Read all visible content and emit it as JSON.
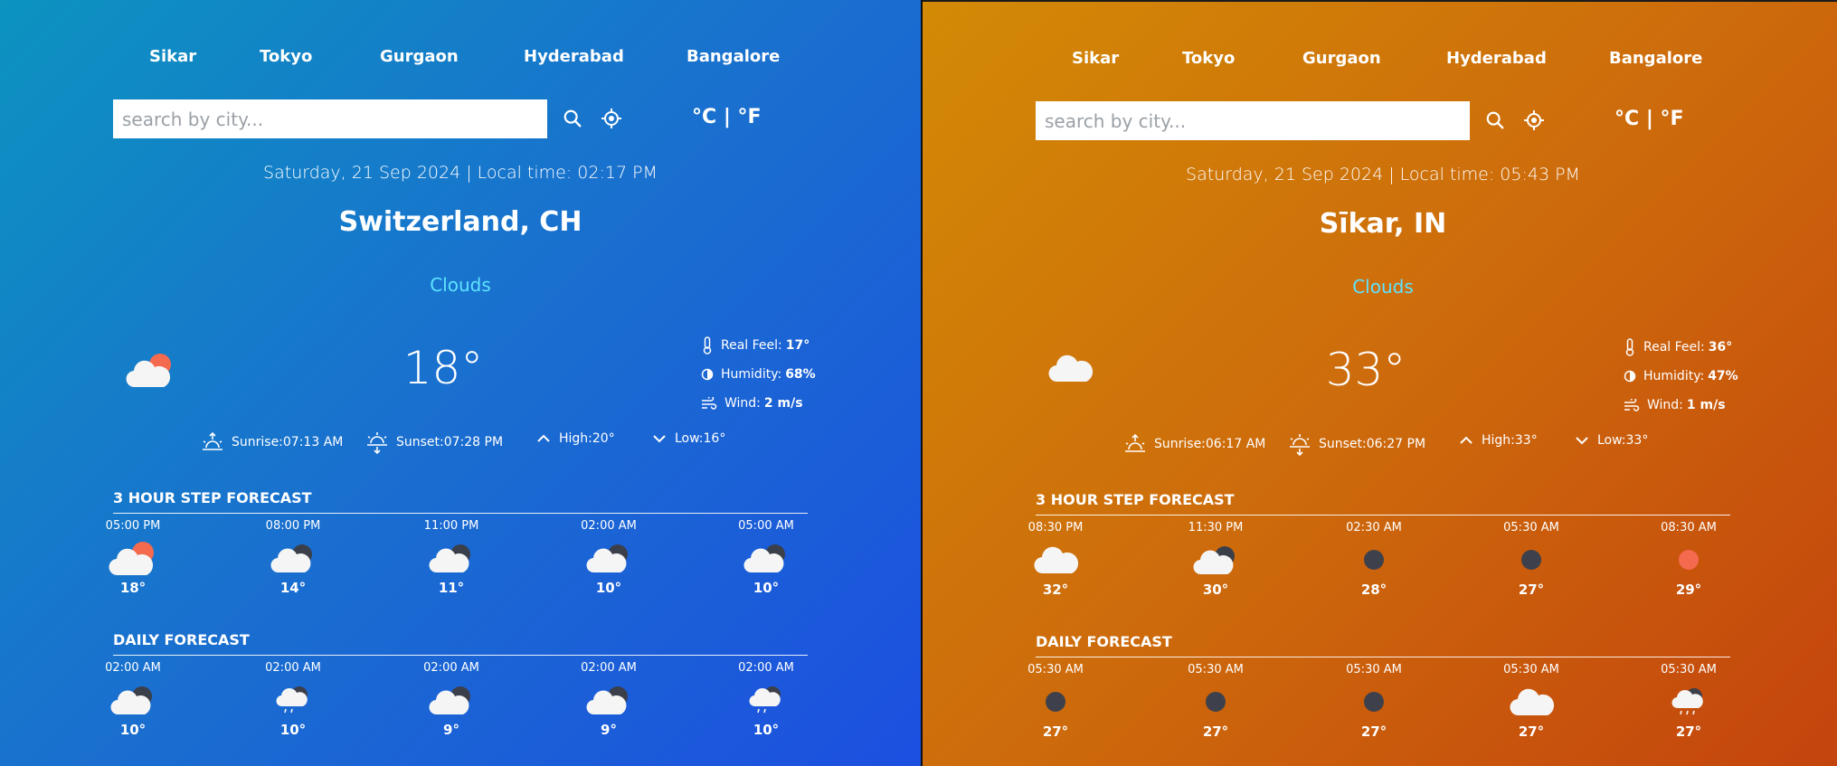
{
  "theme_colors": {
    "left_gradient": [
      "#0c93c0",
      "#1c4fe0"
    ],
    "right_gradient": [
      "#d38a05",
      "#c4440d"
    ],
    "condition_color": "#5fe3ff"
  },
  "panels": [
    {
      "cities": [
        "Sikar",
        "Tokyo",
        "Gurgaon",
        "Hyderabad",
        "Bangalore"
      ],
      "search": {
        "placeholder": "search by city...",
        "value": ""
      },
      "units": {
        "celsius": "°C",
        "separator": "|",
        "fahrenheit": "°F"
      },
      "datetime": "Saturday, 21 Sep 2024 | Local time: 02:17 PM",
      "location": "Switzerland, CH",
      "condition": "Clouds",
      "main_icon": "cloud-sun-icon",
      "temperature": "18°",
      "details": {
        "real_feel_label": "Real Feel:",
        "real_feel": "17°",
        "humidity_label": "Humidity:",
        "humidity": "68%",
        "wind_label": "Wind:",
        "wind": "2 m/s"
      },
      "sun": {
        "sunrise": "Sunrise:07:13 AM",
        "sunset": "Sunset:07:28 PM",
        "high": "High:20°",
        "low": "Low:16°"
      },
      "hourly_title": "3 HOUR STEP FORECAST",
      "hourly": [
        {
          "time": "05:00 PM",
          "temp": "18°",
          "icon": "cloud-sun-icon"
        },
        {
          "time": "08:00 PM",
          "temp": "14°",
          "icon": "cloud-moon-icon"
        },
        {
          "time": "11:00 PM",
          "temp": "11°",
          "icon": "cloud-moon-icon"
        },
        {
          "time": "02:00 AM",
          "temp": "10°",
          "icon": "cloud-moon-icon"
        },
        {
          "time": "05:00 AM",
          "temp": "10°",
          "icon": "cloud-moon-icon"
        }
      ],
      "daily_title": "DAILY FORECAST",
      "daily": [
        {
          "time": "02:00 AM",
          "temp": "10°",
          "icon": "cloud-moon-icon"
        },
        {
          "time": "02:00 AM",
          "temp": "10°",
          "icon": "cloud-moon-rain-icon"
        },
        {
          "time": "02:00 AM",
          "temp": "9°",
          "icon": "cloud-moon-icon"
        },
        {
          "time": "02:00 AM",
          "temp": "9°",
          "icon": "cloud-moon-icon"
        },
        {
          "time": "02:00 AM",
          "temp": "10°",
          "icon": "cloud-moon-rain-icon"
        }
      ]
    },
    {
      "cities": [
        "Sikar",
        "Tokyo",
        "Gurgaon",
        "Hyderabad",
        "Bangalore"
      ],
      "search": {
        "placeholder": "search by city...",
        "value": ""
      },
      "units": {
        "celsius": "°C",
        "separator": "|",
        "fahrenheit": "°F"
      },
      "datetime": "Saturday, 21 Sep 2024 | Local time: 05:43 PM",
      "location": "Sīkar, IN",
      "condition": "Clouds",
      "main_icon": "cloud-icon",
      "temperature": "33°",
      "details": {
        "real_feel_label": "Real Feel:",
        "real_feel": "36°",
        "humidity_label": "Humidity:",
        "humidity": "47%",
        "wind_label": "Wind:",
        "wind": "1 m/s"
      },
      "sun": {
        "sunrise": "Sunrise:06:17 AM",
        "sunset": "Sunset:06:27 PM",
        "high": "High:33°",
        "low": "Low:33°"
      },
      "hourly_title": "3 HOUR STEP FORECAST",
      "hourly": [
        {
          "time": "08:30 PM",
          "temp": "32°",
          "icon": "cloud-icon"
        },
        {
          "time": "11:30 PM",
          "temp": "30°",
          "icon": "cloud-moon-icon"
        },
        {
          "time": "02:30 AM",
          "temp": "28°",
          "icon": "moon-icon"
        },
        {
          "time": "05:30 AM",
          "temp": "27°",
          "icon": "moon-icon"
        },
        {
          "time": "08:30 AM",
          "temp": "29°",
          "icon": "sun-icon"
        }
      ],
      "daily_title": "DAILY FORECAST",
      "daily": [
        {
          "time": "05:30 AM",
          "temp": "27°",
          "icon": "moon-icon"
        },
        {
          "time": "05:30 AM",
          "temp": "27°",
          "icon": "moon-icon"
        },
        {
          "time": "05:30 AM",
          "temp": "27°",
          "icon": "moon-icon"
        },
        {
          "time": "05:30 AM",
          "temp": "27°",
          "icon": "cloud-icon"
        },
        {
          "time": "05:30 AM",
          "temp": "27°",
          "icon": "cloud-rain-icon"
        }
      ]
    }
  ]
}
